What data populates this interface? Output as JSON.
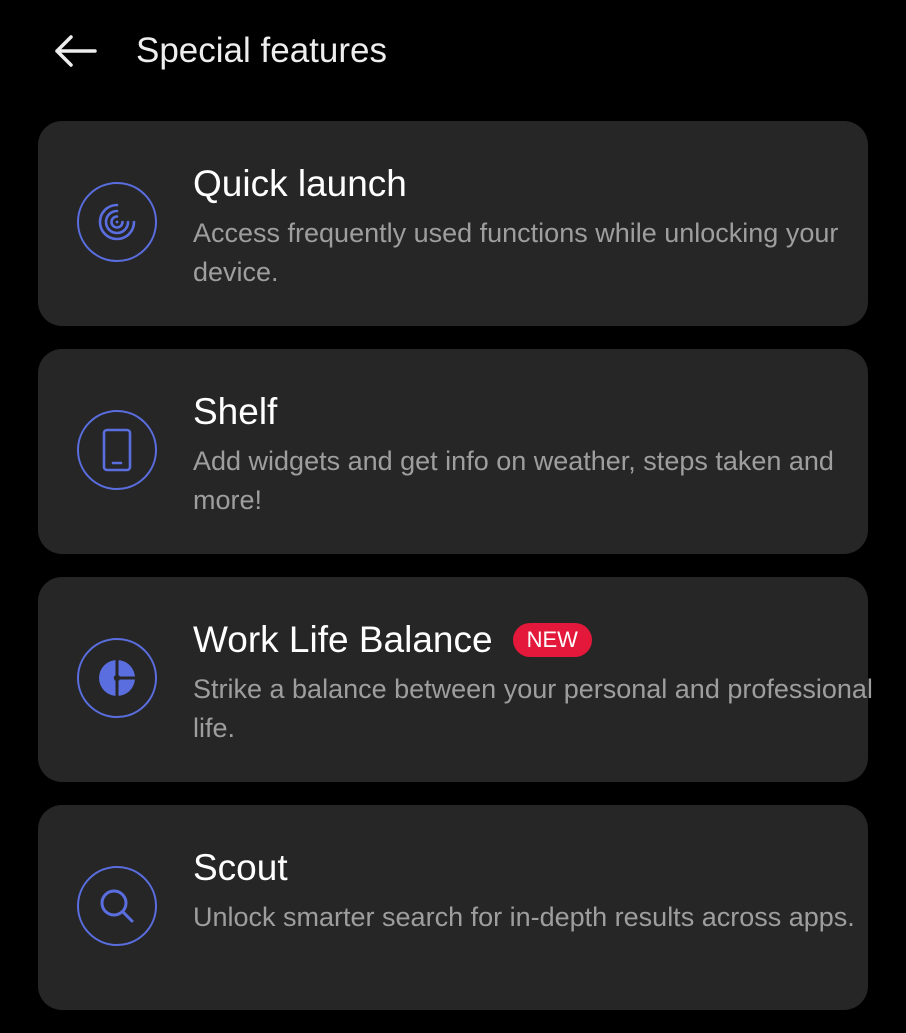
{
  "header": {
    "title": "Special features",
    "back_icon": "arrow-left-icon"
  },
  "colors": {
    "background": "#000000",
    "card_background": "#262626",
    "accent": "#5a6ee0",
    "badge": "#e3183b",
    "title_text": "#ffffff",
    "desc_text": "#9e9e9e"
  },
  "features": [
    {
      "icon": "quick-launch-fingerprint-icon",
      "title": "Quick launch",
      "description": "Access frequently used functions while unlocking your device."
    },
    {
      "icon": "shelf-phone-icon",
      "title": "Shelf",
      "description": "Add widgets and get info on weather, steps taken and more!"
    },
    {
      "icon": "work-life-balance-icon",
      "title": "Work Life Balance",
      "badge": "NEW",
      "description": "Strike a balance between your personal and professional life."
    },
    {
      "icon": "search-icon",
      "title": "Scout",
      "description": "Unlock smarter search for in-depth results across apps."
    }
  ]
}
